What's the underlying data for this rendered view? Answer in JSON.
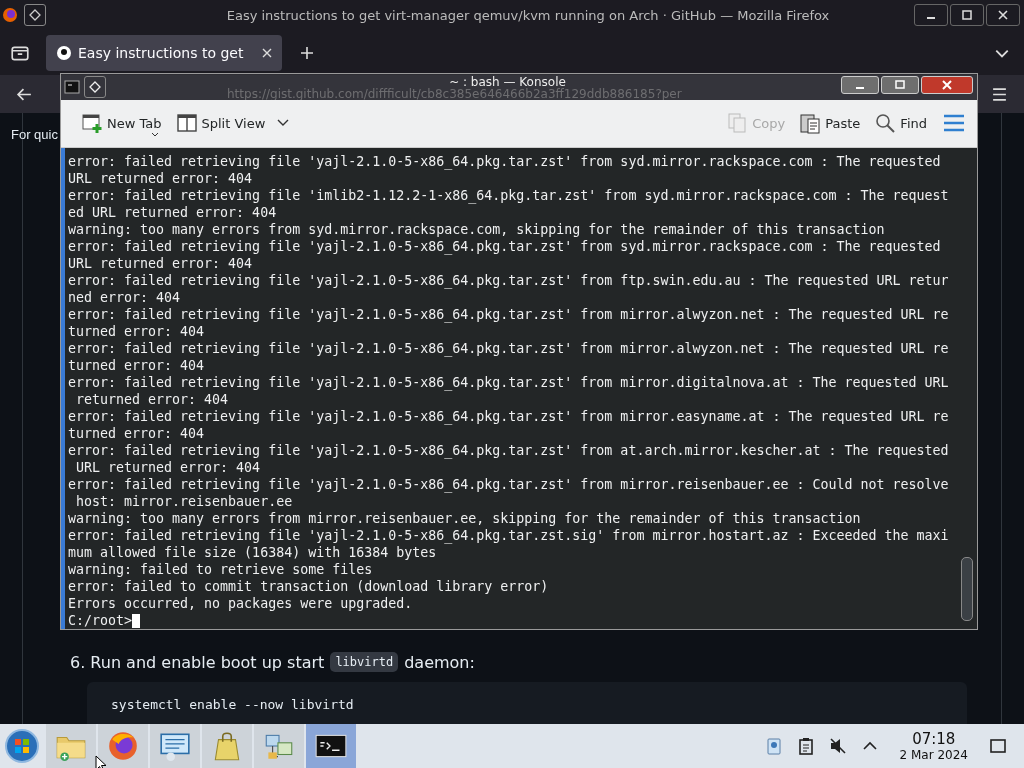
{
  "browser": {
    "title": "Easy instructions to get virt-manager qemuv/kvm running on Arch · GitHub — Mozilla Firefox",
    "tabs": [
      {
        "label": "Easy instructions to get",
        "selected": true
      }
    ],
    "url": "https://gist.github.com/diffficult/cb8c385e646466b2a3ff129ddb886185?per",
    "page": {
      "intro": "For quic",
      "step_before": "6. Run and enable boot up start",
      "step_code": "libvirtd",
      "step_after": "daemon:",
      "code_block": "systemctl enable --now libvirtd"
    }
  },
  "konsole": {
    "title": "~ : bash — Konsole",
    "toolbar": [
      {
        "kind": "new-tab",
        "label": "New Tab",
        "disabled": false
      },
      {
        "kind": "split-view",
        "label": "Split View",
        "disabled": false
      },
      {
        "kind": "copy",
        "label": "Copy",
        "disabled": true
      },
      {
        "kind": "paste",
        "label": "Paste",
        "disabled": false
      },
      {
        "kind": "find",
        "label": "Find",
        "disabled": false
      }
    ],
    "lines": [
      "error: failed retrieving file 'yajl-2.1.0-5-x86_64.pkg.tar.zst' from syd.mirror.rackspace.com : The requested",
      "URL returned error: 404",
      "error: failed retrieving file 'imlib2-1.12.2-1-x86_64.pkg.tar.zst' from syd.mirror.rackspace.com : The request",
      "ed URL returned error: 404",
      "warning: too many errors from syd.mirror.rackspace.com, skipping for the remainder of this transaction",
      "error: failed retrieving file 'yajl-2.1.0-5-x86_64.pkg.tar.zst' from syd.mirror.rackspace.com : The requested",
      "URL returned error: 404",
      "error: failed retrieving file 'yajl-2.1.0-5-x86_64.pkg.tar.zst' from ftp.swin.edu.au : The requested URL retur",
      "ned error: 404",
      "error: failed retrieving file 'yajl-2.1.0-5-x86_64.pkg.tar.zst' from mirror.alwyzon.net : The requested URL re",
      "turned error: 404",
      "error: failed retrieving file 'yajl-2.1.0-5-x86_64.pkg.tar.zst' from mirror.alwyzon.net : The requested URL re",
      "turned error: 404",
      "error: failed retrieving file 'yajl-2.1.0-5-x86_64.pkg.tar.zst' from mirror.digitalnova.at : The requested URL",
      " returned error: 404",
      "error: failed retrieving file 'yajl-2.1.0-5-x86_64.pkg.tar.zst' from mirror.easyname.at : The requested URL re",
      "turned error: 404",
      "error: failed retrieving file 'yajl-2.1.0-5-x86_64.pkg.tar.zst' from at.arch.mirror.kescher.at : The requested",
      " URL returned error: 404",
      "error: failed retrieving file 'yajl-2.1.0-5-x86_64.pkg.tar.zst' from mirror.reisenbauer.ee : Could not resolve",
      " host: mirror.reisenbauer.ee",
      "warning: too many errors from mirror.reisenbauer.ee, skipping for the remainder of this transaction",
      "error: failed retrieving file 'yajl-2.1.0-5-x86_64.pkg.tar.zst.sig' from mirror.hostart.az : Exceeded the maxi",
      "mum allowed file size (16384) with 16384 bytes",
      "warning: failed to retrieve some files",
      "error: failed to commit transaction (download library error)",
      "Errors occurred, no packages were upgraded."
    ],
    "prompt": "C:/root>"
  },
  "taskbar": {
    "apps": [
      {
        "kind": "folder",
        "selected": false
      },
      {
        "kind": "browser",
        "selected": false
      },
      {
        "kind": "monitor",
        "selected": false
      },
      {
        "kind": "bag",
        "selected": false
      },
      {
        "kind": "network",
        "selected": false
      },
      {
        "kind": "terminal",
        "selected": true
      }
    ],
    "clock": {
      "time": "07:18",
      "date": "2 Mar 2024"
    }
  }
}
